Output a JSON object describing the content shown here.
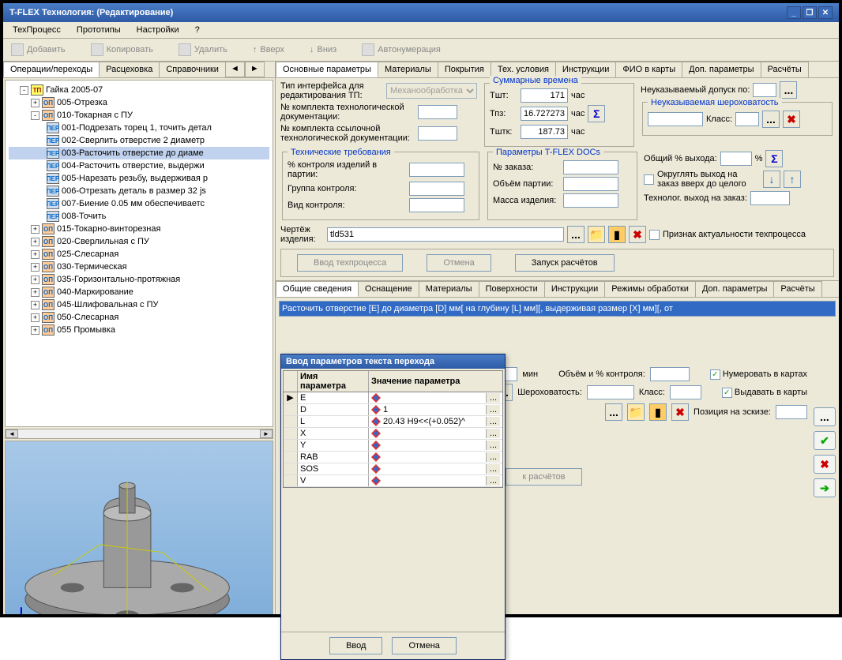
{
  "window": {
    "title": "T-FLEX Технология: (Редактирование)"
  },
  "menubar": [
    "ТехПроцесс",
    "Прототипы",
    "Настройки",
    "?"
  ],
  "toolbar": [
    "Добавить",
    "Копировать",
    "Удалить",
    "Вверх",
    "Вниз",
    "Автонумерация"
  ],
  "left_tabs": {
    "t0": "Операции/переходы",
    "t1": "Расцеховка",
    "t2": "Справочники"
  },
  "tree": {
    "root": "Гайка 2005-07",
    "ops": [
      {
        "exp": "+",
        "code": "005-Отрезка",
        "children": []
      },
      {
        "exp": "-",
        "code": "010-Токарная с ПУ",
        "children": [
          "001-Подрезать торец 1, точить детал",
          "002-Сверлить отверстие 2 диаметр",
          "003-Расточить отверстие  до диаме",
          "004-Расточить отверстие, выдержи",
          "005-Нарезать резьбу, выдерживая р",
          "006-Отрезать деталь в размер 32 js",
          "007-Биение 0.05 мм обеспечиваетс",
          "008-Точить"
        ]
      },
      {
        "exp": "+",
        "code": "015-Токарно-винторезная"
      },
      {
        "exp": "+",
        "code": "020-Сверлильная с ПУ"
      },
      {
        "exp": "+",
        "code": "025-Слесарная"
      },
      {
        "exp": "+",
        "code": "030-Термическая"
      },
      {
        "exp": "+",
        "code": "035-Горизонтально-протяжная"
      },
      {
        "exp": "+",
        "code": "040-Маркирование"
      },
      {
        "exp": "+",
        "code": "045-Шлифовальная с ПУ"
      },
      {
        "exp": "+",
        "code": "050-Слесарная"
      },
      {
        "exp": "+",
        "code": "055 Промывка"
      }
    ],
    "selected_child_index": 2
  },
  "right_tabs_top": [
    "Основные параметры",
    "Материалы",
    "Покрытия",
    "Тех. условия",
    "Инструкции",
    "ФИО в карты",
    "Доп. параметры",
    "Расчёты"
  ],
  "form": {
    "iface_label": "Тип интерфейса для редактирования ТП:",
    "iface_value": "Механообработка",
    "doc1_label": "№ комплекта технологической документации:",
    "doc2_label": "№ комплекта ссылочной технологической документации:",
    "sumtime_title": "Суммарные времена",
    "t_sht_l": "Тшт:",
    "t_sht_v": "171",
    "unit": "час",
    "t_pz_l": "Тпз:",
    "t_pz_v": "16.727273",
    "t_shtk_l": "Тштк:",
    "t_shtk_v": "187.73",
    "tolerance_l": "Неуказываемый допуск по:",
    "rough_title": "Неуказываемая шероховатость",
    "class_l": "Класс:",
    "tech_req_title": "Технические требования",
    "pct_ctrl_l": "% контроля изделий в партии:",
    "grp_ctrl_l": "Группа контроля:",
    "vid_ctrl_l": "Вид контроля:",
    "docs_title": "Параметры T-FLEX DOCs",
    "order_l": "№ заказа:",
    "vol_l": "Объём партии:",
    "mass_l": "Масса изделия:",
    "pct_out_l": "Общий % выхода:",
    "pct_sym": "%",
    "round_l": "Округлять выход на заказ вверх до целого",
    "tech_out_l": "Технолог. выход на заказ:",
    "draw_l": "Чертёж изделия:",
    "draw_v": "tld531",
    "actual_l": "Признак актуальности техпроцесса",
    "enter_tp": "Ввод техпроцесса",
    "cancel": "Отмена",
    "run_calc": "Запуск расчётов"
  },
  "right_tabs_bottom": [
    "Общие сведения",
    "Оснащение",
    "Материалы",
    "Поверхности",
    "Инструкции",
    "Режимы обработки",
    "Доп. параметры",
    "Расчёты"
  ],
  "trans_text": "Расточить отверстие [E] до диаметра [D] мм[ на глубину [L] мм][, выдерживая размер [X] мм][, от",
  "lower_form": {
    "min": "мин",
    "vol_ctrl_l": "Объём и % контроля:",
    "num_cards": "Нумеровать в картах",
    "out_cards": "Выдавать в карты",
    "rough_l": "Шероховатость:",
    "class_l": "Класс:",
    "pos_l": "Позиция на эскизе:",
    "calc": "к расчётов"
  },
  "dialog": {
    "title": "Ввод параметров текста перехода",
    "col1": "Имя параметра",
    "col2": "Значение параметра",
    "rows": [
      {
        "n": "E",
        "v": ""
      },
      {
        "n": "D",
        "v": "1"
      },
      {
        "n": "L",
        "v": "20.43 H9<<(+0.052)^"
      },
      {
        "n": "X",
        "v": ""
      },
      {
        "n": "Y",
        "v": ""
      },
      {
        "n": "RAB",
        "v": ""
      },
      {
        "n": "SOS",
        "v": ""
      },
      {
        "n": "V",
        "v": ""
      }
    ],
    "ok": "Ввод",
    "cancel": "Отмена"
  }
}
